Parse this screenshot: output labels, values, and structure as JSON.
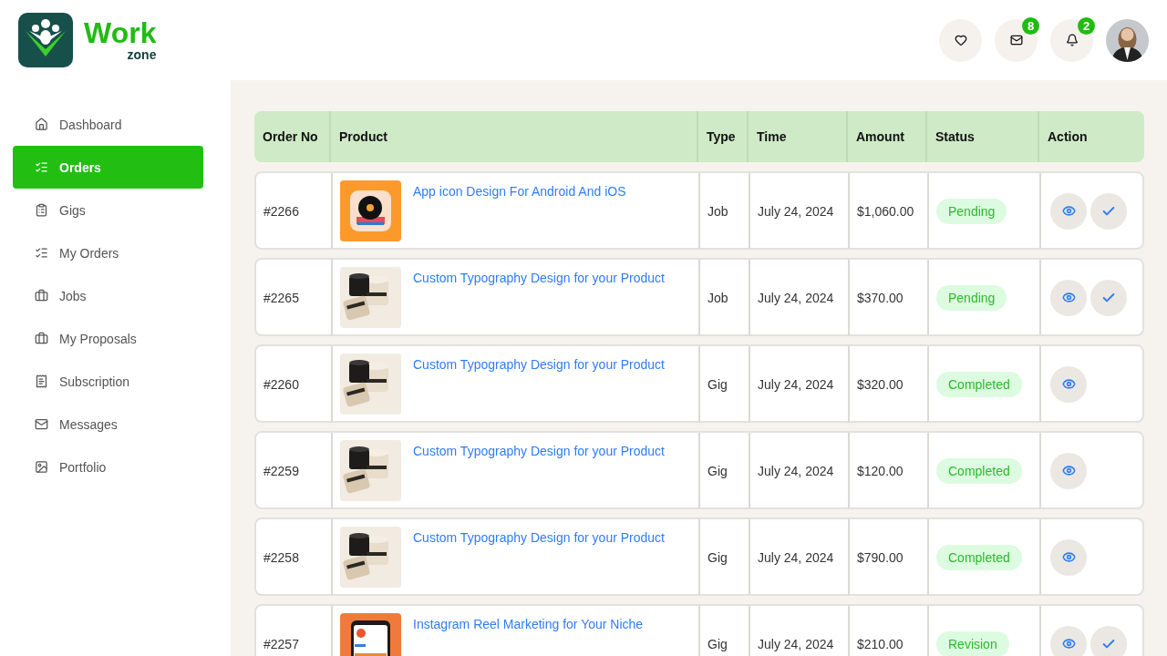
{
  "brand": {
    "name": "Work",
    "sub": "zone"
  },
  "header": {
    "messages_badge": "8",
    "notifications_badge": "2"
  },
  "sidebar": {
    "items": [
      {
        "label": "Dashboard",
        "selected": false
      },
      {
        "label": "Orders",
        "selected": true
      },
      {
        "label": "Gigs",
        "selected": false
      },
      {
        "label": "My Orders",
        "selected": false
      },
      {
        "label": "Jobs",
        "selected": false
      },
      {
        "label": "My Proposals",
        "selected": false
      },
      {
        "label": "Subscription",
        "selected": false
      },
      {
        "label": "Messages",
        "selected": false
      },
      {
        "label": "Portfolio",
        "selected": false
      }
    ]
  },
  "table": {
    "columns": [
      "Order No",
      "Product",
      "Type",
      "Time",
      "Amount",
      "Status",
      "Action"
    ],
    "rows": [
      {
        "order": "#2266",
        "product": "App icon Design For Android And iOS",
        "type": "Job",
        "time": "July 24, 2024",
        "amount": "$1,060.00",
        "status": "Pending",
        "actions": [
          {
            "kind": "view"
          },
          {
            "kind": "approve"
          }
        ]
      },
      {
        "order": "#2265",
        "product": "Custom Typography Design for your Product",
        "type": "Job",
        "time": "July 24, 2024",
        "amount": "$370.00",
        "status": "Pending",
        "actions": [
          {
            "kind": "view"
          },
          {
            "kind": "approve"
          }
        ]
      },
      {
        "order": "#2260",
        "product": "Custom Typography Design for your Product",
        "type": "Gig",
        "time": "July 24, 2024",
        "amount": "$320.00",
        "status": "Completed",
        "actions": [
          {
            "kind": "view"
          }
        ]
      },
      {
        "order": "#2259",
        "product": "Custom Typography Design for your Product",
        "type": "Gig",
        "time": "July 24, 2024",
        "amount": "$120.00",
        "status": "Completed",
        "actions": [
          {
            "kind": "view"
          }
        ]
      },
      {
        "order": "#2258",
        "product": "Custom Typography Design for your Product",
        "type": "Gig",
        "time": "July 24, 2024",
        "amount": "$790.00",
        "status": "Completed",
        "actions": [
          {
            "kind": "view"
          }
        ]
      },
      {
        "order": "#2257",
        "product": "Instagram Reel Marketing for Your Niche",
        "type": "Gig",
        "time": "July 24, 2024",
        "amount": "$210.00",
        "status": "Revision",
        "actions": [
          {
            "kind": "view"
          },
          {
            "kind": "approve"
          }
        ]
      }
    ]
  }
}
